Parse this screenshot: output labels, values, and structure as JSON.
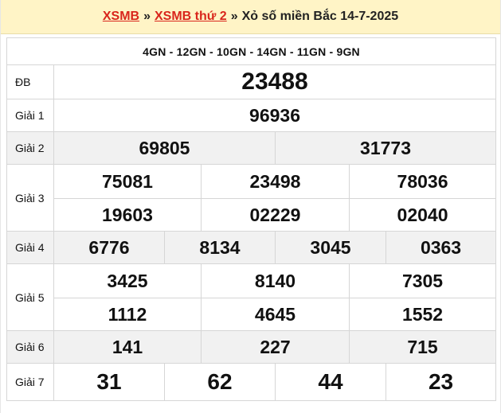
{
  "header": {
    "link1": "XSMB",
    "sep1": "»",
    "link2": "XSMB thứ 2",
    "sep2": "»",
    "title": "Xỏ số miền Bắc 14-7-2025"
  },
  "loto_gan": "4GN - 12GN - 10GN - 14GN - 11GN - 9GN",
  "prizes": {
    "db": {
      "label": "ĐB",
      "values": [
        "23488"
      ]
    },
    "g1": {
      "label": "Giải 1",
      "values": [
        "96936"
      ]
    },
    "g2": {
      "label": "Giải 2",
      "values": [
        "69805",
        "31773"
      ]
    },
    "g3": {
      "label": "Giải 3",
      "values": [
        "75081",
        "23498",
        "78036",
        "19603",
        "02229",
        "02040"
      ]
    },
    "g4": {
      "label": "Giải 4",
      "values": [
        "6776",
        "8134",
        "3045",
        "0363"
      ]
    },
    "g5": {
      "label": "Giải 5",
      "values": [
        "3425",
        "8140",
        "7305",
        "1112",
        "4645",
        "1552"
      ]
    },
    "g6": {
      "label": "Giải 6",
      "values": [
        "141",
        "227",
        "715"
      ]
    },
    "g7": {
      "label": "Giải 7",
      "values": [
        "31",
        "62",
        "44",
        "23"
      ]
    }
  },
  "colors": {
    "accent_red": "#e02424",
    "loto_blue": "#1a6fb5",
    "title_bg": "#fff4c6"
  }
}
